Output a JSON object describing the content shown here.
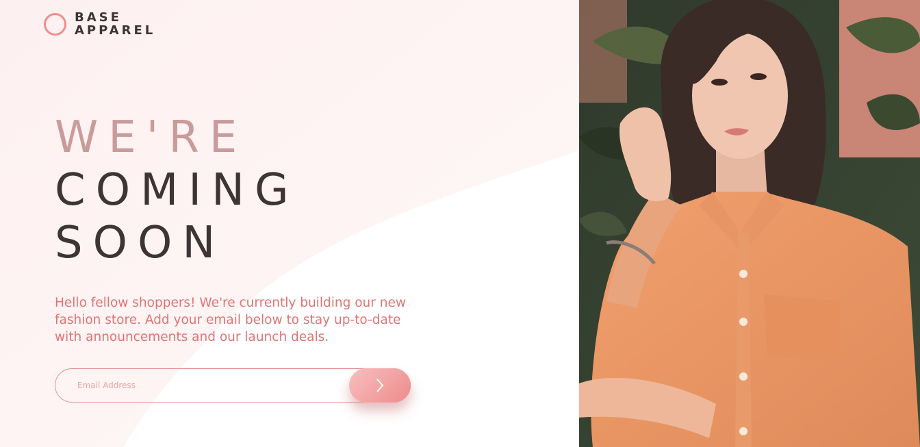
{
  "brand": {
    "line1": "BASE",
    "line2": "APPAREL",
    "accent_color": "#ee8f8f"
  },
  "headline": {
    "light": "WE'RE",
    "line2": "COMING",
    "line3": "SOON"
  },
  "intro_text": "Hello fellow shoppers! We're currently building our new fashion store. Add your email below to stay up-to-date with announcements and our launch deals.",
  "form": {
    "email_placeholder": "Email Address",
    "submit_icon": "chevron-right-icon"
  },
  "colors": {
    "text_dark": "#3e3435",
    "text_pink": "#e07474",
    "background": "#fdf3f3"
  }
}
